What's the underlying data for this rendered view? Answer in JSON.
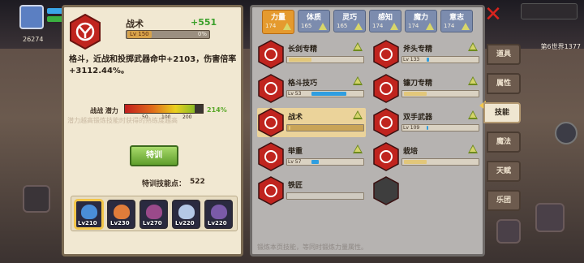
{
  "hud": {
    "gold": "26274",
    "world_label": "第6世界1377"
  },
  "detail": {
    "skill_name": "战术",
    "gain": "+551",
    "level": "Lv 150",
    "level_pct": "0%",
    "description": "格斗，近战和投掷武器命中+2103，伤害倍率+3112.44%。",
    "potential_label": "战战 潜力",
    "potential_ticks": [
      "50",
      "100",
      "200"
    ],
    "potential_pct": "214%",
    "potential_value": 0.9,
    "note": "潜力越高锻炼技能时获得的熟练度越高",
    "train_button": "特训",
    "train_points_label": "特训技能点：",
    "train_points": "522"
  },
  "heroes": [
    {
      "level": "Lv210",
      "color": "#4a8ed8",
      "active": true
    },
    {
      "level": "Lv230",
      "color": "#e07c3a",
      "active": false
    },
    {
      "level": "Lv270",
      "color": "#9a4a8a",
      "active": false
    },
    {
      "level": "Lv220",
      "color": "#b4c8e6",
      "active": false
    },
    {
      "level": "Lv220",
      "color": "#7a5aa8",
      "active": false
    }
  ],
  "stat_tabs": [
    {
      "name": "力量",
      "value": "174",
      "active": true
    },
    {
      "name": "体质",
      "value": "165",
      "active": false
    },
    {
      "name": "灵巧",
      "value": "165",
      "active": false
    },
    {
      "name": "感知",
      "value": "174",
      "active": false
    },
    {
      "name": "魔力",
      "value": "174",
      "active": false
    },
    {
      "name": "意志",
      "value": "174",
      "active": false
    }
  ],
  "skills": [
    {
      "name": "长剑专精",
      "level": "",
      "fill": 0.3,
      "type": "gray",
      "selected": false
    },
    {
      "name": "斧头专精",
      "level": "Lv 133",
      "fill": 0.05,
      "type": "blue",
      "selected": false
    },
    {
      "name": "格斗技巧",
      "level": "Lv 53",
      "fill": 0.7,
      "type": "blue",
      "selected": false
    },
    {
      "name": "镰刀专精",
      "level": "",
      "fill": 0.3,
      "type": "gray",
      "selected": false
    },
    {
      "name": "战术",
      "level": "",
      "fill": 0.0,
      "type": "gray",
      "selected": true
    },
    {
      "name": "双手武器",
      "level": "Lv 109",
      "fill": 0.03,
      "type": "blue",
      "selected": false
    },
    {
      "name": "举重",
      "level": "Lv 57",
      "fill": 0.15,
      "type": "blue",
      "selected": false
    },
    {
      "name": "栽培",
      "level": "",
      "fill": 0.3,
      "type": "gray",
      "selected": false
    },
    {
      "name": "铁匠",
      "level": "",
      "fill": 0.0,
      "type": "none",
      "selected": false
    },
    {
      "name": "",
      "level": "",
      "fill": 0.0,
      "type": "empty",
      "selected": false
    }
  ],
  "bottom_note": "锻炼本页技能，等同时锻炼力量属性。",
  "side_tabs": [
    {
      "label": "道具",
      "active": false
    },
    {
      "label": "属性",
      "active": false
    },
    {
      "label": "技能",
      "active": true
    },
    {
      "label": "魔法",
      "active": false
    },
    {
      "label": "天赋",
      "active": false
    },
    {
      "label": "乐团",
      "active": false
    }
  ],
  "colors": {
    "panel": "#f1e8d2",
    "accent_orange": "#e59a2e",
    "hex_red": "#c0241e",
    "train_green": "#5f9e2c",
    "close_red": "#d9241e"
  },
  "icons": [
    "tactics-icon",
    "sword-icon",
    "axe-icon",
    "fist-icon",
    "scythe-icon",
    "two-handed-icon",
    "barbell-icon",
    "sprout-icon",
    "anvil-icon",
    "close-icon"
  ]
}
